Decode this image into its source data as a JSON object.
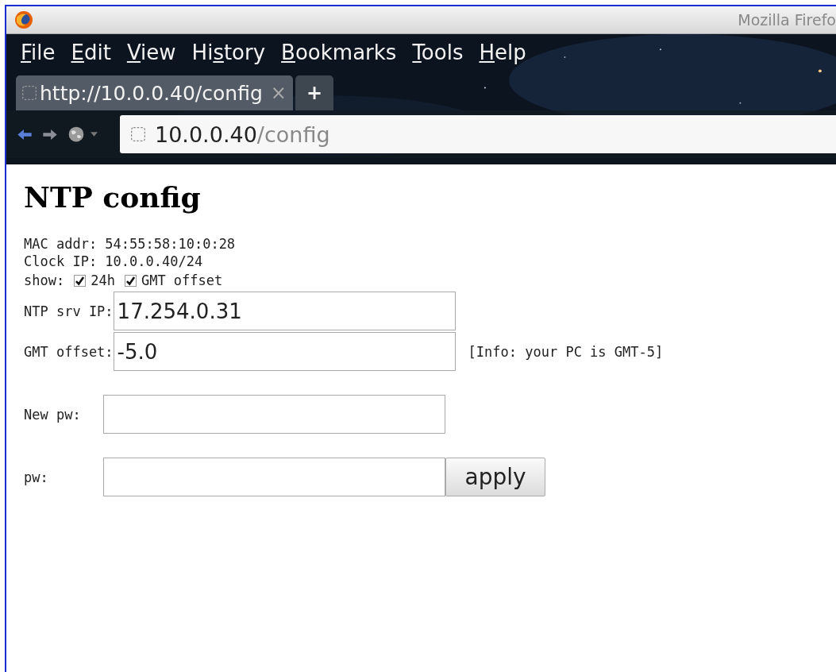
{
  "window": {
    "title": "Mozilla Firefo"
  },
  "menu": [
    {
      "key": "F",
      "after": "ile"
    },
    {
      "key": "E",
      "after": "dit"
    },
    {
      "key": "V",
      "after": "iew"
    },
    {
      "before": "Hi",
      "key": "s",
      "after": "tory"
    },
    {
      "key": "B",
      "after": "ookmarks"
    },
    {
      "key": "T",
      "after": "ools"
    },
    {
      "key": "H",
      "after": "elp"
    }
  ],
  "tabs": [
    {
      "label": "http://10.0.0.40/config",
      "close": "×",
      "selected": true
    }
  ],
  "new_tab": "+",
  "address": {
    "host": "10.0.0.40",
    "path": "/config"
  },
  "page": {
    "heading": "NTP config",
    "info_lines": [
      "MAC addr: 54:55:58:10:0:28",
      "Clock IP: 10.0.0.40/24"
    ],
    "show": {
      "label": "show:",
      "options": [
        {
          "label": "24h",
          "checked": true
        },
        {
          "label": "GMT offset",
          "checked": true
        }
      ]
    },
    "fields": [
      {
        "kind": "wide",
        "label": "NTP srv IP:",
        "value": "17.254.0.31"
      },
      {
        "kind": "wide",
        "label": "GMT offset:",
        "value": "-5.0",
        "note": "[Info: your PC is GMT-5]"
      },
      {
        "kind": "password",
        "label": "New pw:"
      },
      {
        "kind": "password",
        "label": "pw:",
        "button": "apply"
      }
    ]
  }
}
